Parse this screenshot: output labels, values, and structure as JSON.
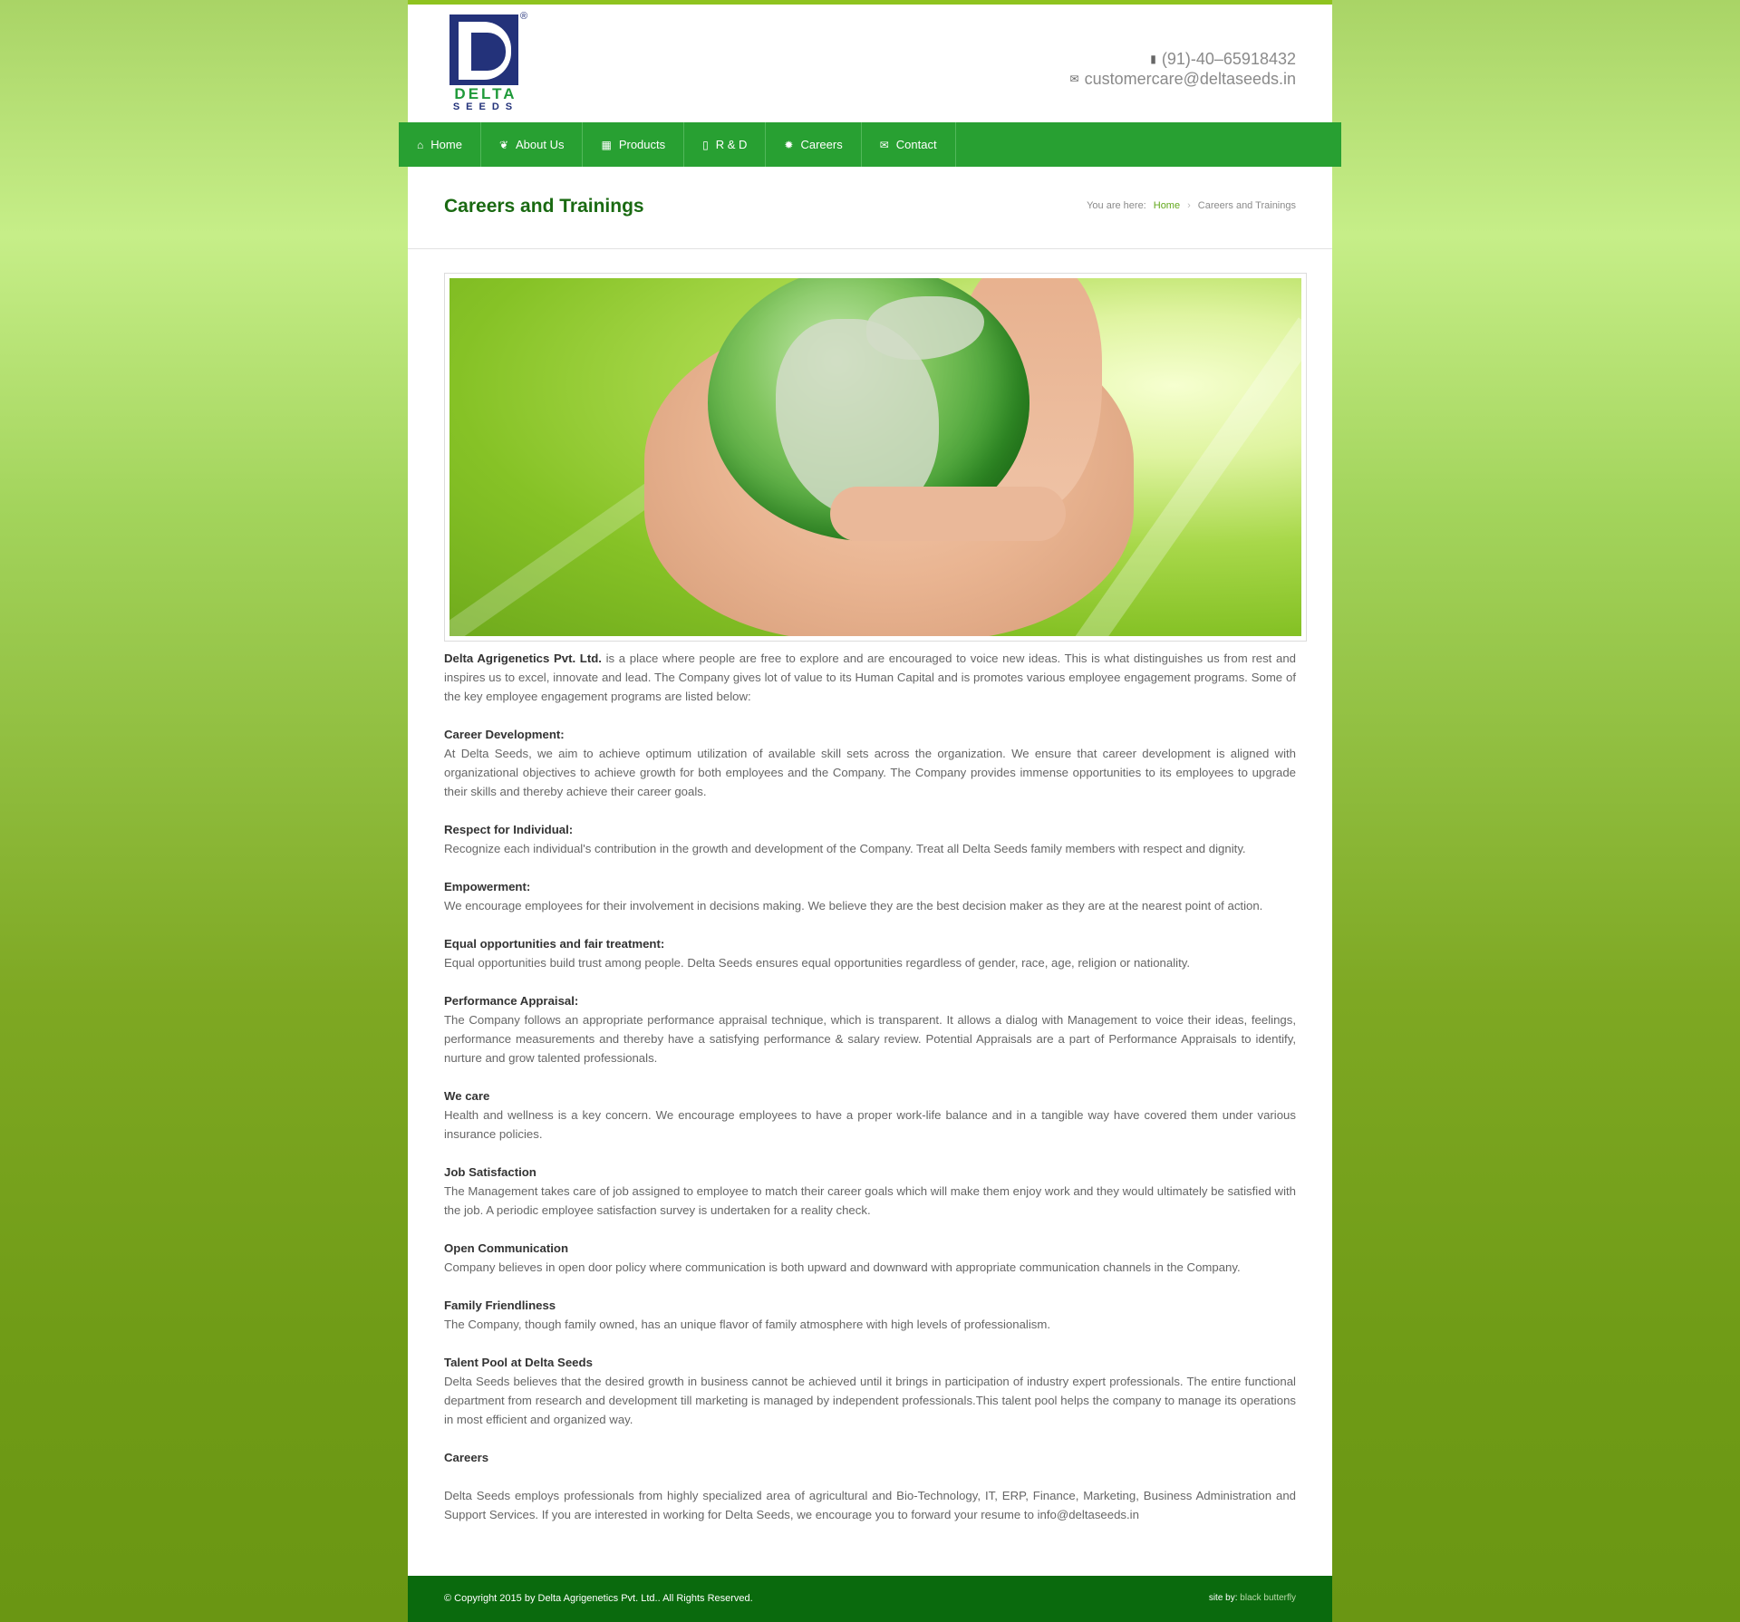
{
  "brand": {
    "logo_text_top": "DELTA",
    "logo_text_bottom": "SEEDS",
    "logo_mark": "®",
    "colors": {
      "green": "#28a032",
      "navy": "#23327a",
      "footer": "#0a6a0d"
    }
  },
  "contact": {
    "phone": "(91)-40–65918432",
    "phone_icon": "mobile-phone-icon",
    "email": "customercare@deltaseeds.in",
    "email_icon": "envelope-icon"
  },
  "nav": {
    "items": [
      {
        "label": "Home",
        "icon": "home-icon"
      },
      {
        "label": "About Us",
        "icon": "leaf-icon"
      },
      {
        "label": "Products",
        "icon": "grid-icon"
      },
      {
        "label": "R & D",
        "icon": "book-icon"
      },
      {
        "label": "Careers",
        "icon": "gear-icon"
      },
      {
        "label": "Contact",
        "icon": "envelope-icon"
      }
    ]
  },
  "page": {
    "title": "Careers and Trainings",
    "breadcrumb": {
      "prefix": "You are here:",
      "home": "Home",
      "current": "Careers and Trainings"
    }
  },
  "content": {
    "intro_bold": "Delta Agrigenetics Pvt. Ltd.",
    "intro_text": " is a place where people are free to explore and are encouraged to voice new ideas. This is what distinguishes us from rest and inspires us to excel, innovate and lead. The Company gives lot of value to its Human Capital and is promotes various employee engagement programs. Some of the key employee engagement programs are listed below:",
    "sections": [
      {
        "heading": "Career Development:",
        "text": "At Delta Seeds, we aim to achieve optimum utilization of available skill sets across the organization. We ensure that career development is aligned with organizational objectives to achieve growth for both employees and the Company. The Company provides immense opportunities to its employees to upgrade their skills and thereby achieve their career goals."
      },
      {
        "heading": "Respect for Individual:",
        "text": "Recognize each individual's contribution in the growth and development of the Company. Treat all Delta Seeds family members with respect and dignity."
      },
      {
        "heading": "Empowerment:",
        "text": "We encourage employees for their involvement in decisions making. We believe they are the best decision maker as they are at the nearest point of action."
      },
      {
        "heading": "Equal opportunities and fair treatment:",
        "text": "Equal opportunities build trust among people. Delta Seeds ensures equal opportunities regardless of gender, race, age, religion or nationality."
      },
      {
        "heading": "Performance Appraisal:",
        "text": "The Company follows an appropriate performance appraisal technique, which is transparent. It allows a dialog with Management to voice their ideas, feelings, performance measurements and thereby have a satisfying performance & salary review. Potential Appraisals are a part of Performance Appraisals to identify, nurture and grow talented professionals."
      },
      {
        "heading": "We care",
        "text": "Health and wellness is a key concern. We encourage employees to have a proper work-life balance and in a tangible way have covered them under various insurance policies."
      },
      {
        "heading": "Job Satisfaction",
        "text": "The Management takes care of job assigned to employee to match their career goals which will make them enjoy work and they would ultimately be satisfied with the job. A periodic employee satisfaction survey is undertaken for a reality check."
      },
      {
        "heading": "Open Communication",
        "text": "Company believes in open door policy where communication is both upward and downward with appropriate communication channels in the Company."
      },
      {
        "heading": "Family Friendliness",
        "text": "The Company, though family owned, has an unique flavor of family atmosphere with high levels of professionalism."
      },
      {
        "heading": "Talent Pool at Delta Seeds",
        "text": "Delta Seeds believes that the desired growth in business cannot be achieved until it brings in participation of industry expert professionals. The entire functional department from research and development till marketing is managed by independent professionals.This talent pool helps the company to manage its operations in most efficient and organized way."
      }
    ],
    "careers_heading": "Careers",
    "careers_text": "Delta Seeds employs professionals from highly specialized area of agricultural and Bio-Technology, IT, ERP, Finance, Marketing, Business Administration and Support Services. If you are interested in working for Delta Seeds, we encourage you to forward your resume to info@deltaseeds.in"
  },
  "footer": {
    "copyright": "© Copyright 2015 by Delta Agrigenetics Pvt. Ltd.. All Rights Reserved.",
    "site_by_label": "site by:",
    "site_by_link": "black butterfly"
  }
}
